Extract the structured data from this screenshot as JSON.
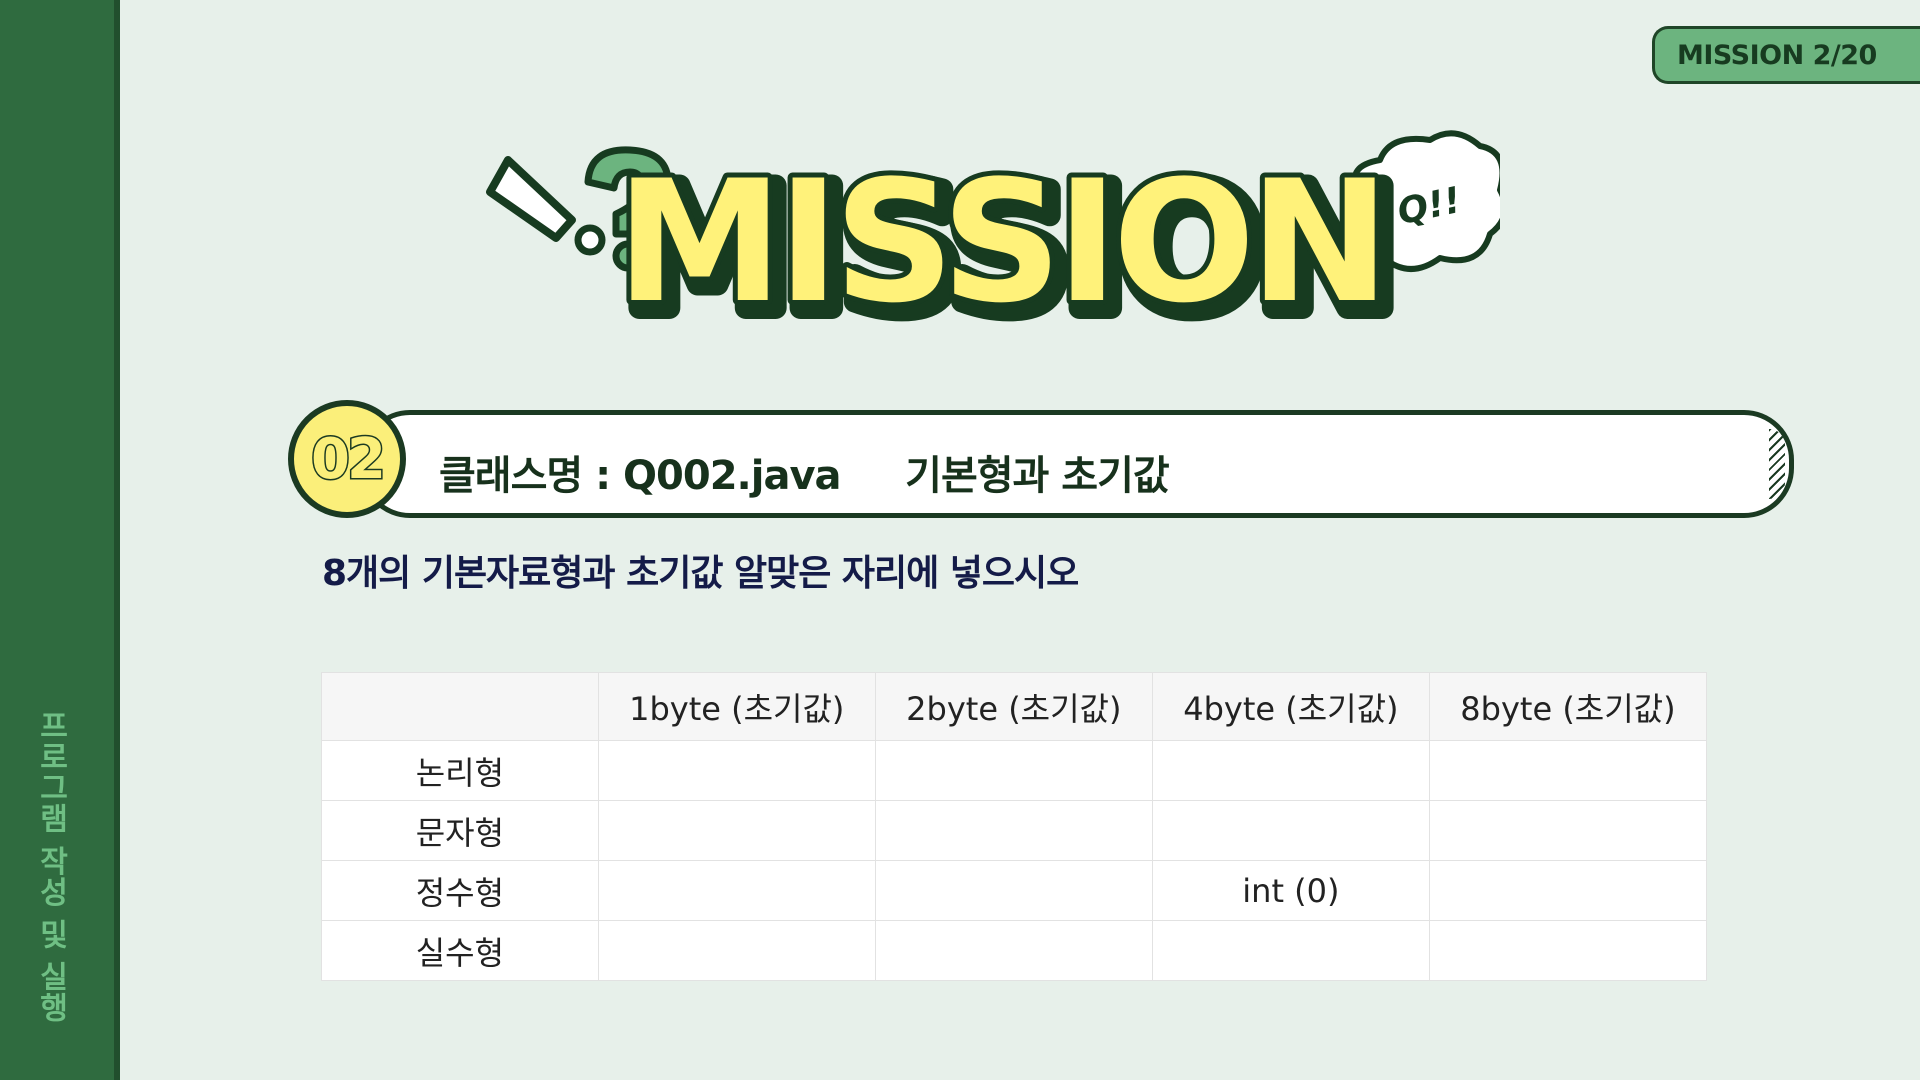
{
  "sidebar": {
    "vertical_label": "프로그램 작성 및 실행"
  },
  "badge": {
    "label": "MISSION 2/20"
  },
  "hero": {
    "title": "MISSION",
    "bubble_text": "Q!!",
    "colors": {
      "title_fill": "#fff27a",
      "outline": "#173b20",
      "question_mark": "#6cb47f"
    }
  },
  "mission": {
    "number": "02",
    "header_text": "클래스명 : Q002.java     기본형과 초기값",
    "instruction": "8개의 기본자료형과 초기값 알맞은 자리에 넣으시오"
  },
  "table": {
    "columns": [
      "",
      "1byte (초기값)",
      "2byte (초기값)",
      "4byte (초기값)",
      "8byte (초기값)"
    ],
    "rows": [
      {
        "label": "논리형",
        "cells": [
          "",
          "",
          "",
          ""
        ]
      },
      {
        "label": "문자형",
        "cells": [
          "",
          "",
          "",
          ""
        ]
      },
      {
        "label": "정수형",
        "cells": [
          "",
          "",
          "int  (0)",
          ""
        ]
      },
      {
        "label": "실수형",
        "cells": [
          "",
          "",
          "",
          ""
        ]
      }
    ]
  },
  "colors": {
    "sidebar": "#2f6b3f",
    "background": "#e7f0ea",
    "accent_yellow": "#fbef7a",
    "dark_green": "#1b3a22"
  }
}
